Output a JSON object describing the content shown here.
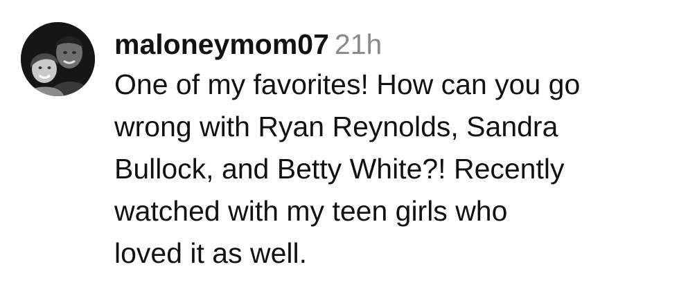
{
  "comment": {
    "username": "maloneymom07",
    "timestamp": "21h",
    "avatar_icon": "profile-photo-avatar",
    "text_lines": [
      "One of my favorites! How can you go",
      "wrong with Ryan Reynolds, Sandra",
      "Bullock, and Betty White?! Recently",
      "watched with my teen girls who",
      "loved it as well."
    ]
  },
  "colors": {
    "text": "#111111",
    "timestamp": "#8a8a8a",
    "background": "#ffffff"
  }
}
